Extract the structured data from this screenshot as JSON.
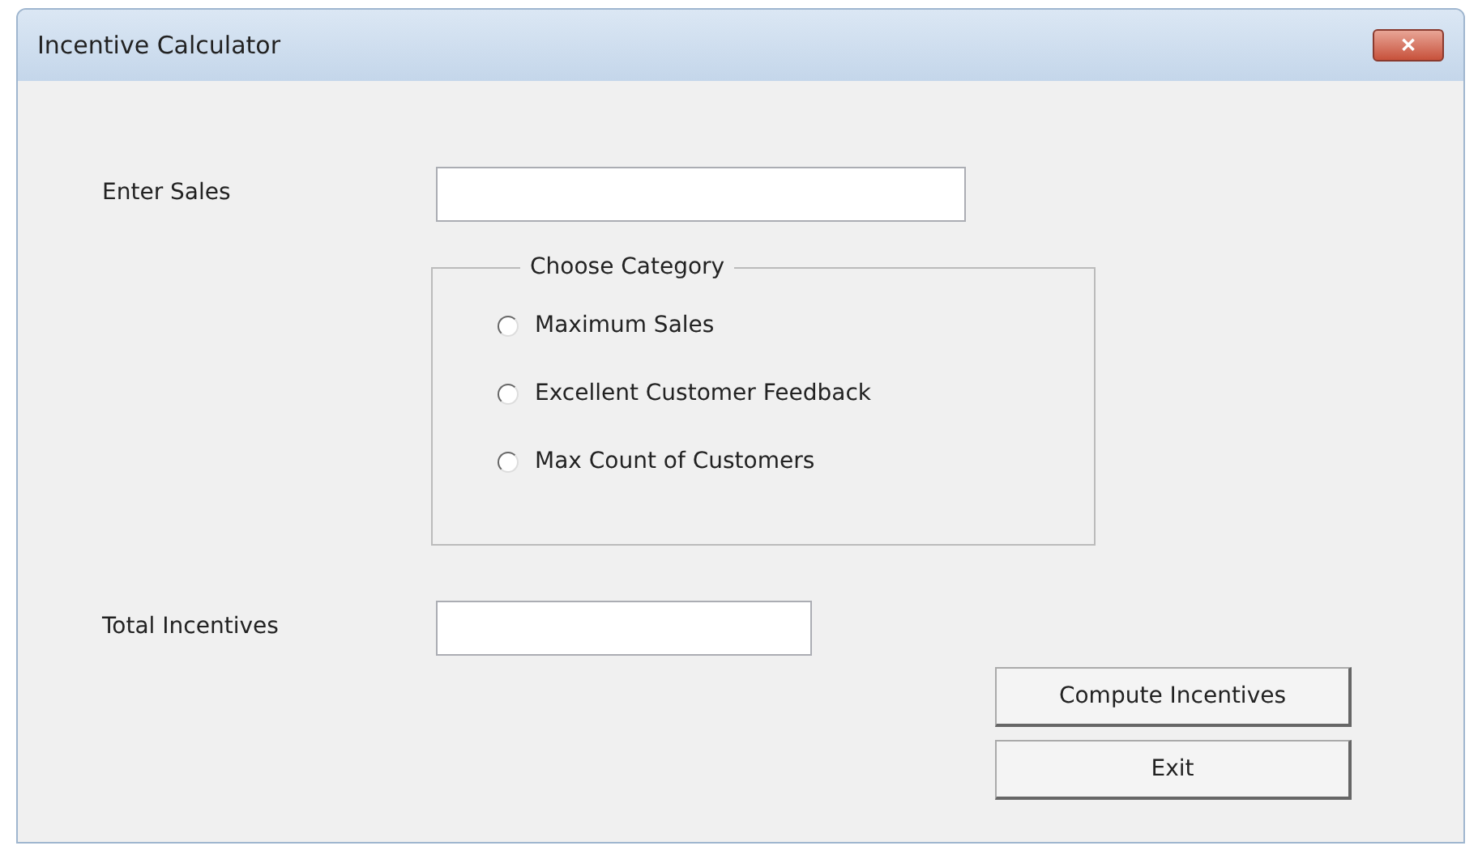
{
  "window": {
    "title": "Incentive Calculator",
    "close_glyph": "✕"
  },
  "sales": {
    "label": "Enter Sales"
  },
  "category": {
    "title": "Choose Category",
    "options": [
      {
        "label": "Maximum Sales",
        "selected": false
      },
      {
        "label": "Excellent Customer Feedback",
        "selected": false
      },
      {
        "label": "Max Count of Customers",
        "selected": false
      }
    ]
  },
  "total": {
    "label": "Total Incentives"
  },
  "buttons": [
    "Compute Incentives",
    "Exit"
  ]
}
